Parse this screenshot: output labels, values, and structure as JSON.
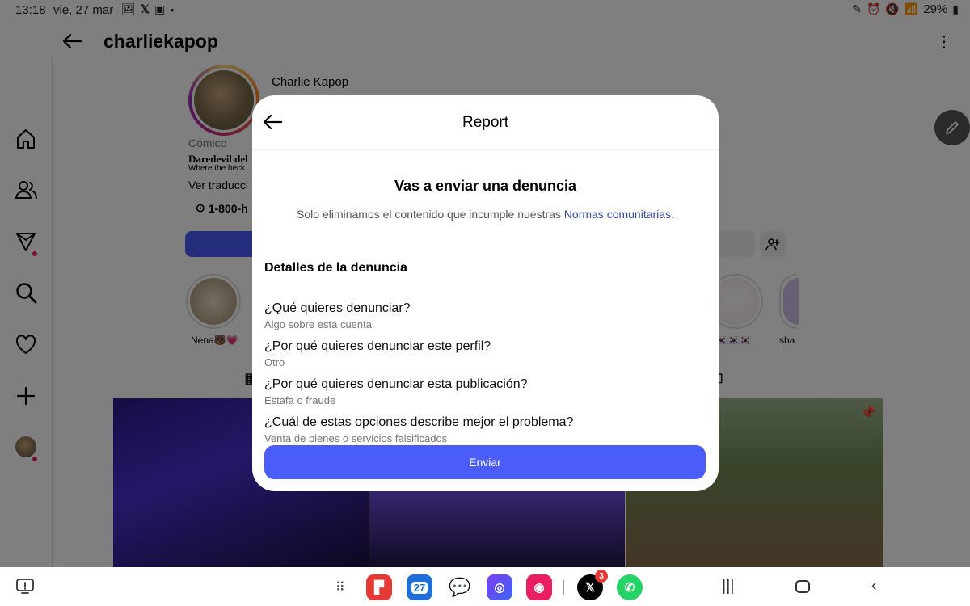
{
  "status_bar": {
    "time": "13:18",
    "date": "vie, 27 mar",
    "battery": "29%",
    "notification_icons": [
      "image-icon",
      "x-icon",
      "gallery-icon"
    ],
    "system_icons": [
      "pen-icon",
      "alarm-icon",
      "mute-icon",
      "wifi-icon",
      "battery-icon"
    ]
  },
  "header": {
    "username": "charliekapop"
  },
  "sidebar": {
    "items": [
      {
        "icon": "home-icon"
      },
      {
        "icon": "profile-icon"
      },
      {
        "icon": "explore-icon",
        "dot": true
      },
      {
        "icon": "search-icon"
      },
      {
        "icon": "heart-icon"
      },
      {
        "icon": "plus-icon"
      },
      {
        "icon": "avatar-icon",
        "dot": true
      }
    ]
  },
  "profile": {
    "full_name": "Charlie Kapop",
    "category": "Cómico",
    "bio_line1": "Daredevil del",
    "bio_line2": "Where the heck",
    "translate": "Ver traducci",
    "phone": "1-800-h"
  },
  "highlights": [
    {
      "label": "Nena🐻💗"
    },
    {
      "label": "🇰🇷🇰🇷🇰🇷"
    },
    {
      "label": "sha"
    }
  ],
  "modal": {
    "title": "Report",
    "heading": "Vas a enviar una denuncia",
    "note_prefix": "Solo eliminamos el contenido que incumple nuestras ",
    "note_link": "Normas comunitarias",
    "note_suffix": ".",
    "details_heading": "Detalles de la denuncia",
    "items": [
      {
        "question": "¿Qué quieres denunciar?",
        "answer": "Algo sobre esta cuenta"
      },
      {
        "question": "¿Por qué quieres denunciar este perfil?",
        "answer": "Otro"
      },
      {
        "question": "¿Por qué quieres denunciar esta publicación?",
        "answer": "Estafa o fraude"
      },
      {
        "question": "¿Cuál de estas opciones describe mejor el problema?",
        "answer": "Venta de bienes o servicios falsificados"
      }
    ],
    "submit_label": "Enviar",
    "accent_color": "#4a5df9",
    "link_color": "#3447a8"
  },
  "navbar": {
    "calendar_day": "27",
    "x_badge": "3",
    "apps": [
      "flipboard-app",
      "calendar-app",
      "messages-app",
      "internet-app",
      "camera-app",
      "x-app",
      "whatsapp-app"
    ],
    "keys": [
      "recents-key",
      "home-key",
      "back-key"
    ]
  }
}
